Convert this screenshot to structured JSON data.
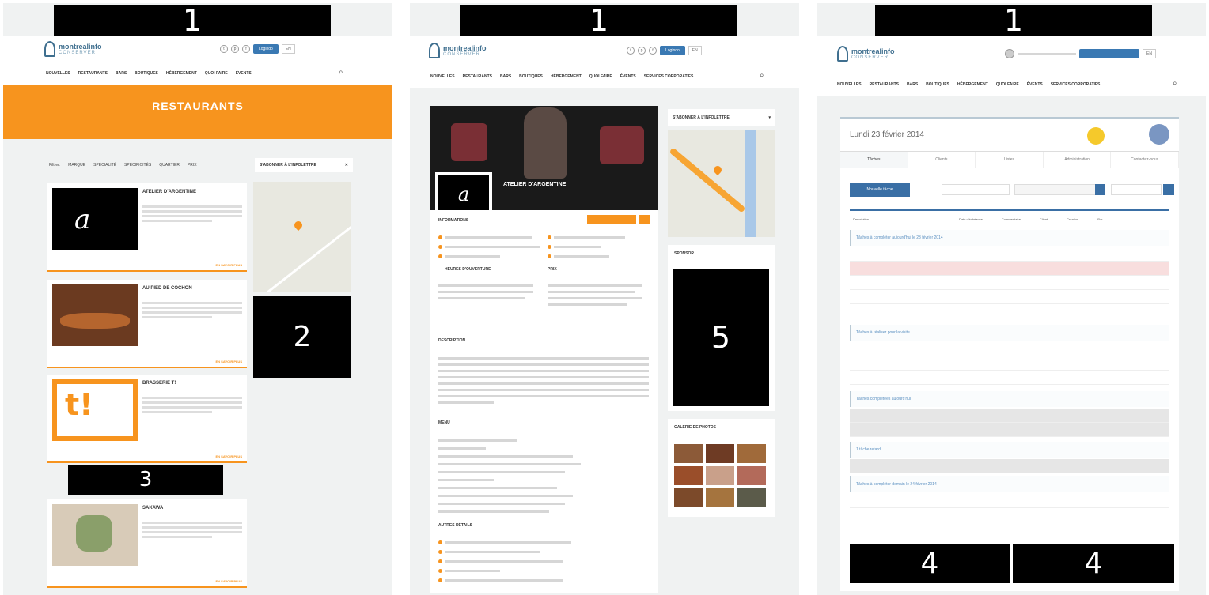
{
  "labels": {
    "panel1": "1",
    "panel2": "1",
    "panel3": "1",
    "map_block": "2",
    "card_block": "3",
    "footer_block": "4",
    "footer_block_2": "4",
    "sidebar_block": "5"
  },
  "site": {
    "logo_main": "montrealinfo",
    "logo_sub": "CONSERVER",
    "login_button": "Logindo",
    "lang": "EN",
    "nav": [
      "NOUVELLES",
      "RESTAURANTS",
      "BARS",
      "BOUTIQUES",
      "HÉBERGEMENT",
      "QUOI FAIRE",
      "ÉVENTS",
      "SERVICES CORPORATIFS"
    ]
  },
  "page1": {
    "banner_title": "RESTAURANTS",
    "filters": [
      "Filtrer:",
      "MARQUE",
      "SPÉCIALITÉ",
      "SPÉCIFICITÉS",
      "QUARTIER",
      "PRIX"
    ],
    "newsletter": "S'ABONNER À L'INFOLETTRE",
    "cards": [
      {
        "title": "ATELIER D'ARGENTINE",
        "more": "EN SAVOIR PLUS"
      },
      {
        "title": "AU PIED DE COCHON",
        "more": "EN SAVOIR PLUS"
      },
      {
        "title": "BRASSERIE T!",
        "more": "EN SAVOIR PLUS"
      },
      {
        "title": "SAKAWA",
        "more": "EN SAVOIR PLUS"
      }
    ]
  },
  "page2": {
    "restaurant_name": "ATELIER D'ARGENTINE",
    "sections": [
      "INFORMATIONS",
      "HEURES D'OUVERTURE",
      "PRIX",
      "DESCRIPTION",
      "MENU",
      "AUTRES DÉTAILS"
    ],
    "newsletter": "S'ABONNER À L'INFOLETTRE",
    "sponsor": "SPONSOR",
    "gallery_title": "GALERIE DE PHOTOS"
  },
  "page3": {
    "date": "Lundi 23 février 2014",
    "tabs": [
      "Tâches",
      "Clients",
      "Listes",
      "Administration",
      "Contactez-nous"
    ],
    "new_task": "Nouvelle tâche",
    "table_headers": [
      "Description",
      "Date d'échéance",
      "Commentaire",
      "Client",
      "Création",
      "Par"
    ],
    "groups": [
      "Tâches à compléter aujourd'hui le 23 février 2014",
      "Tâches à réaliser pour la visite",
      "Tâches complétées aujourd'hui",
      "1 tâche retard",
      "Tâches à compléter demain le 24 février 2014"
    ]
  }
}
